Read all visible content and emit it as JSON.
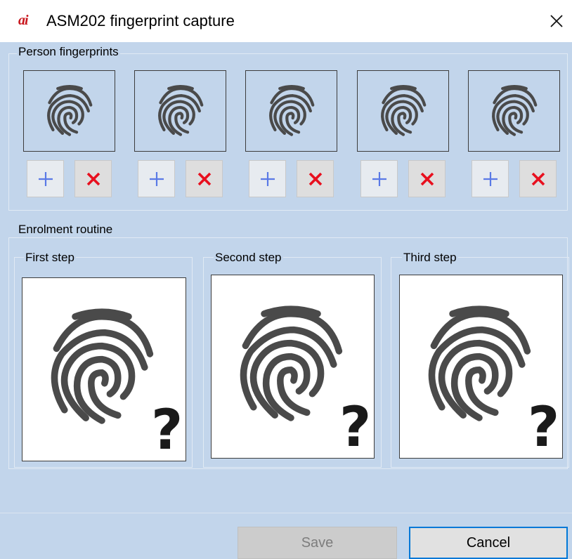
{
  "window": {
    "logo_text": "ai",
    "title": "ASM202 fingerprint capture",
    "close_icon": "close-icon"
  },
  "fingerprints_group": {
    "label": "Person fingerprints",
    "slot_count": 5,
    "add_icon": "plus-icon",
    "remove_icon": "cross-icon",
    "colors": {
      "add": "#5a79e6",
      "remove": "#e8101e"
    }
  },
  "enrolment_group": {
    "label": "Enrolment routine",
    "steps": [
      {
        "label": "First step",
        "status_icon": "question-mark-icon",
        "status_text": "?"
      },
      {
        "label": "Second step",
        "status_icon": "question-mark-icon",
        "status_text": "?"
      },
      {
        "label": "Third step",
        "status_icon": "question-mark-icon",
        "status_text": "?"
      }
    ]
  },
  "buttons": {
    "save_label": "Save",
    "save_enabled": false,
    "cancel_label": "Cancel",
    "cancel_focused": true
  },
  "colors": {
    "background": "#c2d5eb",
    "fingerprint": "#4a4a4a",
    "logo": "#c8161d",
    "focus_border": "#0078d7"
  }
}
